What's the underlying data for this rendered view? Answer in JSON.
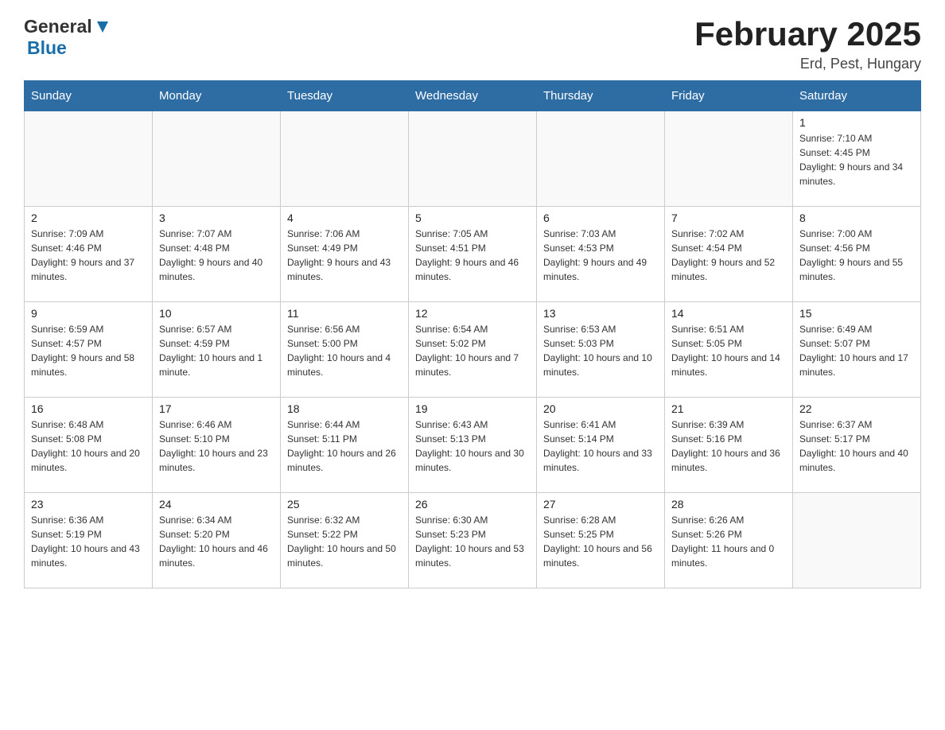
{
  "logo": {
    "text_general": "General",
    "text_blue": "Blue"
  },
  "title": "February 2025",
  "location": "Erd, Pest, Hungary",
  "days_of_week": [
    "Sunday",
    "Monday",
    "Tuesday",
    "Wednesday",
    "Thursday",
    "Friday",
    "Saturday"
  ],
  "weeks": [
    {
      "days": [
        {
          "number": "",
          "info": ""
        },
        {
          "number": "",
          "info": ""
        },
        {
          "number": "",
          "info": ""
        },
        {
          "number": "",
          "info": ""
        },
        {
          "number": "",
          "info": ""
        },
        {
          "number": "",
          "info": ""
        },
        {
          "number": "1",
          "info": "Sunrise: 7:10 AM\nSunset: 4:45 PM\nDaylight: 9 hours and 34 minutes."
        }
      ]
    },
    {
      "days": [
        {
          "number": "2",
          "info": "Sunrise: 7:09 AM\nSunset: 4:46 PM\nDaylight: 9 hours and 37 minutes."
        },
        {
          "number": "3",
          "info": "Sunrise: 7:07 AM\nSunset: 4:48 PM\nDaylight: 9 hours and 40 minutes."
        },
        {
          "number": "4",
          "info": "Sunrise: 7:06 AM\nSunset: 4:49 PM\nDaylight: 9 hours and 43 minutes."
        },
        {
          "number": "5",
          "info": "Sunrise: 7:05 AM\nSunset: 4:51 PM\nDaylight: 9 hours and 46 minutes."
        },
        {
          "number": "6",
          "info": "Sunrise: 7:03 AM\nSunset: 4:53 PM\nDaylight: 9 hours and 49 minutes."
        },
        {
          "number": "7",
          "info": "Sunrise: 7:02 AM\nSunset: 4:54 PM\nDaylight: 9 hours and 52 minutes."
        },
        {
          "number": "8",
          "info": "Sunrise: 7:00 AM\nSunset: 4:56 PM\nDaylight: 9 hours and 55 minutes."
        }
      ]
    },
    {
      "days": [
        {
          "number": "9",
          "info": "Sunrise: 6:59 AM\nSunset: 4:57 PM\nDaylight: 9 hours and 58 minutes."
        },
        {
          "number": "10",
          "info": "Sunrise: 6:57 AM\nSunset: 4:59 PM\nDaylight: 10 hours and 1 minute."
        },
        {
          "number": "11",
          "info": "Sunrise: 6:56 AM\nSunset: 5:00 PM\nDaylight: 10 hours and 4 minutes."
        },
        {
          "number": "12",
          "info": "Sunrise: 6:54 AM\nSunset: 5:02 PM\nDaylight: 10 hours and 7 minutes."
        },
        {
          "number": "13",
          "info": "Sunrise: 6:53 AM\nSunset: 5:03 PM\nDaylight: 10 hours and 10 minutes."
        },
        {
          "number": "14",
          "info": "Sunrise: 6:51 AM\nSunset: 5:05 PM\nDaylight: 10 hours and 14 minutes."
        },
        {
          "number": "15",
          "info": "Sunrise: 6:49 AM\nSunset: 5:07 PM\nDaylight: 10 hours and 17 minutes."
        }
      ]
    },
    {
      "days": [
        {
          "number": "16",
          "info": "Sunrise: 6:48 AM\nSunset: 5:08 PM\nDaylight: 10 hours and 20 minutes."
        },
        {
          "number": "17",
          "info": "Sunrise: 6:46 AM\nSunset: 5:10 PM\nDaylight: 10 hours and 23 minutes."
        },
        {
          "number": "18",
          "info": "Sunrise: 6:44 AM\nSunset: 5:11 PM\nDaylight: 10 hours and 26 minutes."
        },
        {
          "number": "19",
          "info": "Sunrise: 6:43 AM\nSunset: 5:13 PM\nDaylight: 10 hours and 30 minutes."
        },
        {
          "number": "20",
          "info": "Sunrise: 6:41 AM\nSunset: 5:14 PM\nDaylight: 10 hours and 33 minutes."
        },
        {
          "number": "21",
          "info": "Sunrise: 6:39 AM\nSunset: 5:16 PM\nDaylight: 10 hours and 36 minutes."
        },
        {
          "number": "22",
          "info": "Sunrise: 6:37 AM\nSunset: 5:17 PM\nDaylight: 10 hours and 40 minutes."
        }
      ]
    },
    {
      "days": [
        {
          "number": "23",
          "info": "Sunrise: 6:36 AM\nSunset: 5:19 PM\nDaylight: 10 hours and 43 minutes."
        },
        {
          "number": "24",
          "info": "Sunrise: 6:34 AM\nSunset: 5:20 PM\nDaylight: 10 hours and 46 minutes."
        },
        {
          "number": "25",
          "info": "Sunrise: 6:32 AM\nSunset: 5:22 PM\nDaylight: 10 hours and 50 minutes."
        },
        {
          "number": "26",
          "info": "Sunrise: 6:30 AM\nSunset: 5:23 PM\nDaylight: 10 hours and 53 minutes."
        },
        {
          "number": "27",
          "info": "Sunrise: 6:28 AM\nSunset: 5:25 PM\nDaylight: 10 hours and 56 minutes."
        },
        {
          "number": "28",
          "info": "Sunrise: 6:26 AM\nSunset: 5:26 PM\nDaylight: 11 hours and 0 minutes."
        },
        {
          "number": "",
          "info": ""
        }
      ]
    }
  ]
}
